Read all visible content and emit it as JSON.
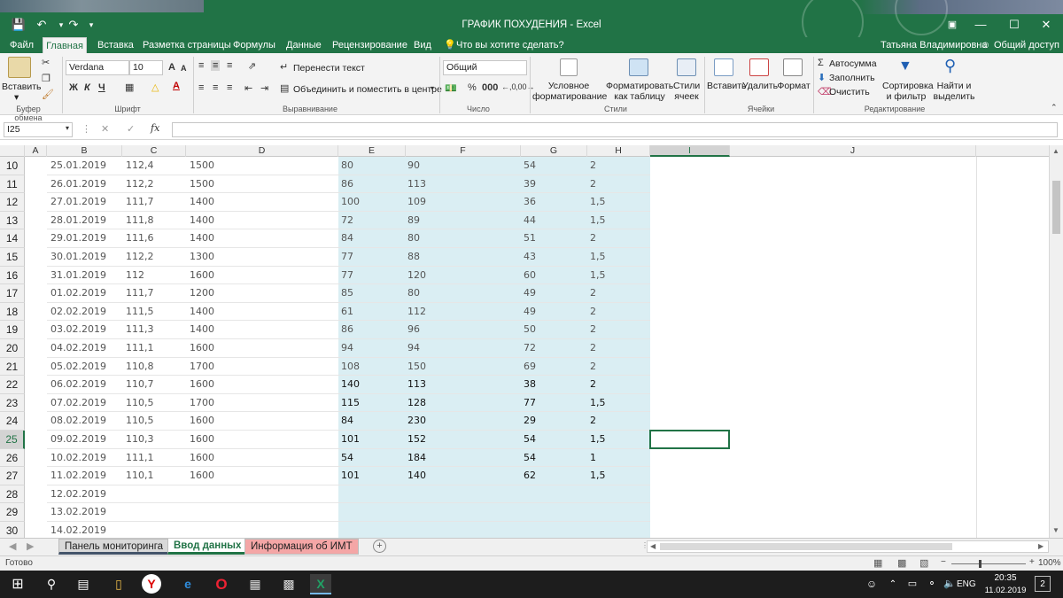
{
  "title_bar": {
    "document_title": "ГРАФИК ПОХУДЕНИЯ - Excel",
    "user": "Татьяна Владимировна",
    "share": "Общий доступ"
  },
  "menu": {
    "tabs": [
      "Файл",
      "Главная",
      "Вставка",
      "Разметка страницы",
      "Формулы",
      "Данные",
      "Рецензирование",
      "Вид"
    ],
    "active": "Главная",
    "search": "Что вы хотите сделать?"
  },
  "ribbon": {
    "clipboard": {
      "paste": "Вставить",
      "group": "Буфер обмена"
    },
    "font": {
      "name": "Verdana",
      "size": "10",
      "bold": "Ж",
      "italic": "К",
      "underline": "Ч",
      "group": "Шрифт"
    },
    "alignment": {
      "wrap": "Перенести текст",
      "merge": "Объединить и поместить в центре",
      "group": "Выравнивание"
    },
    "number": {
      "format": "Общий",
      "group": "Число"
    },
    "styles": {
      "conditional1": "Условное",
      "conditional2": "форматирование",
      "astable1": "Форматировать",
      "astable2": "как таблицу",
      "cellstyles1": "Стили",
      "cellstyles2": "ячеек",
      "group": "Стили"
    },
    "cells": {
      "insert": "Вставить",
      "delete": "Удалить",
      "format": "Формат",
      "group": "Ячейки"
    },
    "editing": {
      "autosum": "Автосумма",
      "fill": "Заполнить",
      "clear": "Очистить",
      "sort1": "Сортировка",
      "sort2": "и фильтр",
      "find1": "Найти и",
      "find2": "выделить",
      "group": "Редактирование"
    }
  },
  "formula_bar": {
    "name_box": "I25",
    "fx": "fx",
    "formula": ""
  },
  "columns": [
    "A",
    "B",
    "C",
    "D",
    "E",
    "F",
    "G",
    "H",
    "I",
    "J"
  ],
  "rows": [
    {
      "n": "10",
      "b": "25.01.2019",
      "c": "112,4",
      "d": "1500",
      "e": "80",
      "f": "90",
      "g": "54",
      "h": "2"
    },
    {
      "n": "11",
      "b": "26.01.2019",
      "c": "112,2",
      "d": "1500",
      "e": "86",
      "f": "113",
      "g": "39",
      "h": "2"
    },
    {
      "n": "12",
      "b": "27.01.2019",
      "c": "111,7",
      "d": "1400",
      "e": "100",
      "f": "109",
      "g": "36",
      "h": "1,5"
    },
    {
      "n": "13",
      "b": "28.01.2019",
      "c": "111,8",
      "d": "1400",
      "e": "72",
      "f": "89",
      "g": "44",
      "h": "1,5"
    },
    {
      "n": "14",
      "b": "29.01.2019",
      "c": "111,6",
      "d": "1400",
      "e": "84",
      "f": "80",
      "g": "51",
      "h": "2"
    },
    {
      "n": "15",
      "b": "30.01.2019",
      "c": "112,2",
      "d": "1300",
      "e": "77",
      "f": "88",
      "g": "43",
      "h": "1,5"
    },
    {
      "n": "16",
      "b": "31.01.2019",
      "c": "112",
      "d": "1600",
      "e": "77",
      "f": "120",
      "g": "60",
      "h": "1,5"
    },
    {
      "n": "17",
      "b": "01.02.2019",
      "c": "111,7",
      "d": "1200",
      "e": "85",
      "f": "80",
      "g": "49",
      "h": "2"
    },
    {
      "n": "18",
      "b": "02.02.2019",
      "c": "111,5",
      "d": "1400",
      "e": "61",
      "f": "112",
      "g": "49",
      "h": "2"
    },
    {
      "n": "19",
      "b": "03.02.2019",
      "c": "111,3",
      "d": "1400",
      "e": "86",
      "f": "96",
      "g": "50",
      "h": "2"
    },
    {
      "n": "20",
      "b": "04.02.2019",
      "c": "111,1",
      "d": "1600",
      "e": "94",
      "f": "94",
      "g": "72",
      "h": "2"
    },
    {
      "n": "21",
      "b": "05.02.2019",
      "c": "110,8",
      "d": "1700",
      "e": "108",
      "f": "150",
      "g": "69",
      "h": "2"
    },
    {
      "n": "22",
      "b": "06.02.2019",
      "c": "110,7",
      "d": "1600",
      "e": "140",
      "f": "113",
      "g": "38",
      "h": "2"
    },
    {
      "n": "23",
      "b": "07.02.2019",
      "c": "110,5",
      "d": "1700",
      "e": "115",
      "f": "128",
      "g": "77",
      "h": "1,5"
    },
    {
      "n": "24",
      "b": "08.02.2019",
      "c": "110,5",
      "d": "1600",
      "e": "84",
      "f": "230",
      "g": "29",
      "h": "2"
    },
    {
      "n": "25",
      "b": "09.02.2019",
      "c": "110,3",
      "d": "1600",
      "e": "101",
      "f": "152",
      "g": "54",
      "h": "1,5"
    },
    {
      "n": "26",
      "b": "10.02.2019",
      "c": "111,1",
      "d": "1600",
      "e": "54",
      "f": "184",
      "g": "54",
      "h": "1"
    },
    {
      "n": "27",
      "b": "11.02.2019",
      "c": "110,1",
      "d": "1600",
      "e": "101",
      "f": "140",
      "g": "62",
      "h": "1,5"
    },
    {
      "n": "28",
      "b": "12.02.2019",
      "c": "",
      "d": "",
      "e": "",
      "f": "",
      "g": "",
      "h": ""
    },
    {
      "n": "29",
      "b": "13.02.2019",
      "c": "",
      "d": "",
      "e": "",
      "f": "",
      "g": "",
      "h": ""
    },
    {
      "n": "30",
      "b": "14.02.2019",
      "c": "",
      "d": "",
      "e": "",
      "f": "",
      "g": "",
      "h": ""
    }
  ],
  "sheet_tabs": [
    {
      "label": "Панель мониторинга",
      "color": "#44546a"
    },
    {
      "label": "Ввод данных",
      "color": "#ffffff"
    },
    {
      "label": "Информация об ИМТ",
      "color": "#f4a6a6"
    }
  ],
  "status": {
    "ready": "Готово",
    "zoom": "100%"
  },
  "taskbar": {
    "lang": "ENG",
    "time": "20:35",
    "date": "11.02.2019",
    "notify": "2"
  },
  "colors": {
    "accent": "#217346",
    "tint": "#daeef3"
  }
}
